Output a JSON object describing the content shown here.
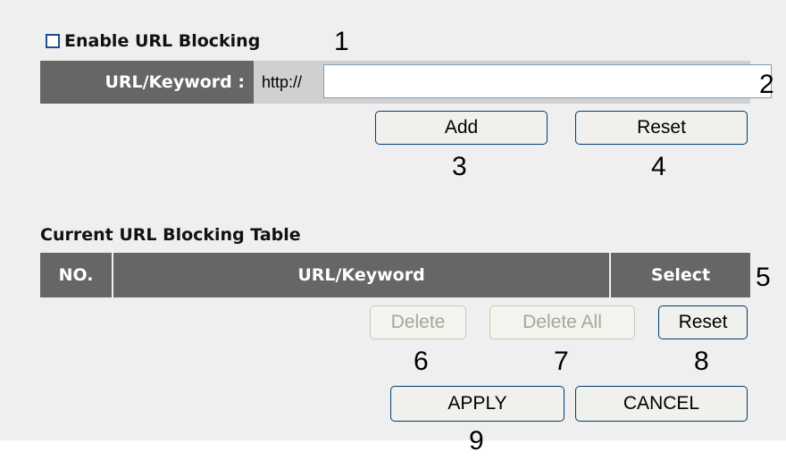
{
  "enable": {
    "label": "Enable URL Blocking",
    "checked": false,
    "marker": "1"
  },
  "url_field": {
    "label": "URL/Keyword :",
    "prefix": "http://",
    "value": "",
    "marker": "2"
  },
  "add_button": {
    "label": "Add",
    "marker": "3"
  },
  "reset_button_top": {
    "label": "Reset",
    "marker": "4"
  },
  "table": {
    "title": "Current URL Blocking Table",
    "headers": [
      "NO.",
      "URL/Keyword",
      "Select"
    ],
    "marker": "5"
  },
  "delete_button": {
    "label": "Delete",
    "marker": "6",
    "disabled": true
  },
  "delete_all_button": {
    "label": "Delete All",
    "marker": "7",
    "disabled": true
  },
  "reset_button_table": {
    "label": "Reset",
    "marker": "8"
  },
  "apply_button": {
    "label": "APPLY"
  },
  "cancel_button": {
    "label": "CANCEL"
  },
  "apply_marker": "9"
}
